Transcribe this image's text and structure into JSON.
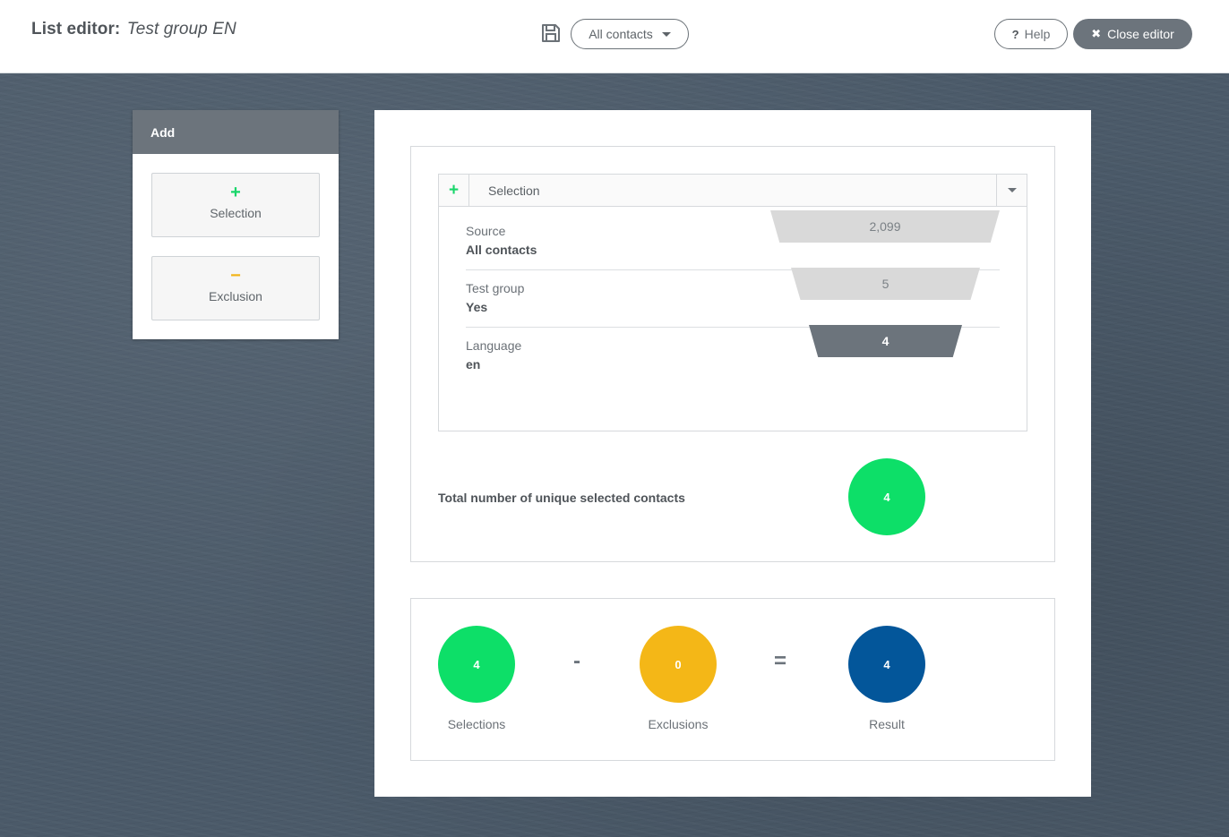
{
  "header": {
    "title_prefix": "List editor:",
    "list_name": "Test group EN",
    "save_icon": "floppy-disk-icon",
    "source_dropdown": "All contacts",
    "help_label": "Help",
    "close_label": "Close editor"
  },
  "add_panel": {
    "title": "Add",
    "items": [
      {
        "symbol": "+",
        "label": "Selection"
      },
      {
        "symbol": "−",
        "label": "Exclusion"
      }
    ]
  },
  "selection": {
    "title": "Selection",
    "criteria": [
      {
        "label": "Source",
        "value": "All contacts",
        "count": "2,099"
      },
      {
        "label": "Test group",
        "value": "Yes",
        "count": "5"
      },
      {
        "label": "Language",
        "value": "en",
        "count": "4"
      }
    ],
    "total_label": "Total number of unique selected contacts",
    "total_count": "4"
  },
  "result": {
    "selections": {
      "value": "4",
      "label": "Selections"
    },
    "minus": "-",
    "exclusions": {
      "value": "0",
      "label": "Exclusions"
    },
    "equals": "=",
    "result": {
      "value": "4",
      "label": "Result"
    }
  },
  "colors": {
    "selection_green": "#0ddf68",
    "exclusion_yellow": "#f4b717",
    "result_blue": "#03569a",
    "header_gray": "#6c747c"
  }
}
